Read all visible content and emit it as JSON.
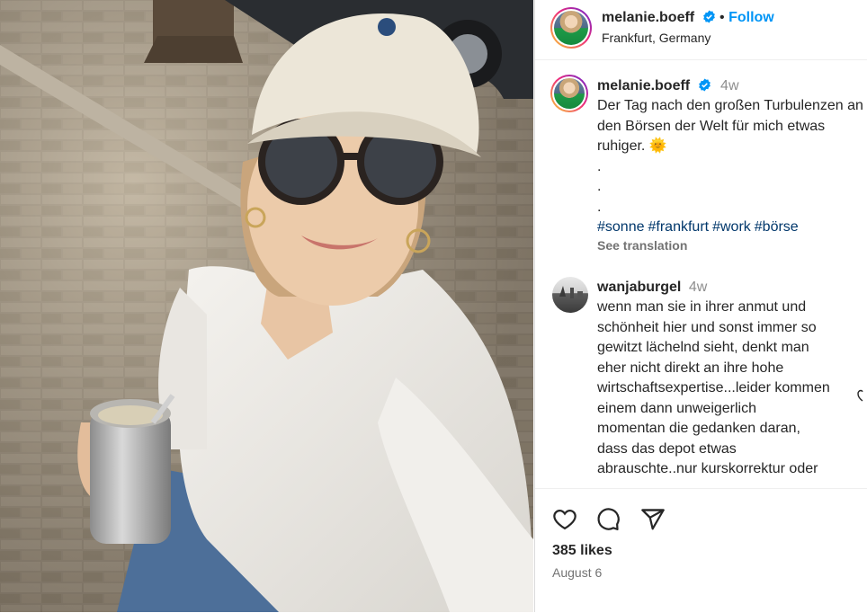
{
  "post": {
    "author": "melanie.boeff",
    "location": "Frankfurt, Germany",
    "follow_label": "Follow",
    "caption": {
      "age": "4w",
      "text": "Der Tag nach den großen Turbulenzen an den Börsen der Welt für mich etwas ruhiger. 🌞",
      "dots": [
        ".",
        ".",
        "."
      ],
      "hashtags": [
        "#sonne",
        "#frankfurt",
        "#work",
        "#börse"
      ],
      "see_translation": "See translation"
    },
    "comments": [
      {
        "user": "wanjaburgel",
        "age": "4w",
        "lines": [
          "wenn man sie in ihrer anmut und",
          "schönheit hier und sonst immer so",
          "gewitzt lächelnd sieht, denkt man",
          "eher nicht direkt an ihre hohe",
          "wirtschaftsexpertise...leider kommen",
          "einem dann unweigerlich",
          "momentan die gedanken daran,",
          "dass das depot etwas",
          "abrauschte..nur kurskorrektur oder"
        ]
      }
    ],
    "likes": "385 likes",
    "date": "August 6"
  },
  "colors": {
    "link_blue": "#0095f6",
    "hashtag_blue": "#00376b",
    "verified_blue": "#0095f6"
  },
  "icons": [
    "heart-icon",
    "comment-icon",
    "share-icon",
    "verified-badge-icon"
  ]
}
